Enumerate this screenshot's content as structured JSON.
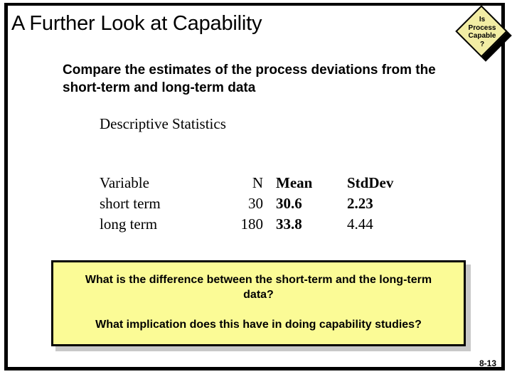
{
  "slide": {
    "title": "A Further Look at Capability",
    "page_number": "8-13",
    "colors": {
      "diamond_fill": "#F2EDA4",
      "callout_fill": "#FBFB96",
      "callout_border": "#000000",
      "callout_shadow": "#C8C8C8",
      "frame": "#000000"
    }
  },
  "diamond": {
    "line1": "Is",
    "line2": "Process",
    "line3": "Capable",
    "line4": "?"
  },
  "body": {
    "bullet": "Compare the estimates of the process deviations from the short-term and long-term data"
  },
  "stats": {
    "caption": "Descriptive Statistics",
    "headers": {
      "variable": "Variable",
      "n": "N",
      "mean": "Mean",
      "stddev": "StdDev"
    },
    "rows": [
      {
        "variable": "short term",
        "n": "30",
        "mean": "30.6",
        "stddev": "2.23"
      },
      {
        "variable": "long term",
        "n": "180",
        "mean": "33.8",
        "stddev": "4.44"
      }
    ]
  },
  "callout": {
    "question1": "What is the difference between the short-term and the long-term data?",
    "question2": "What implication does this have in doing capability studies?"
  }
}
